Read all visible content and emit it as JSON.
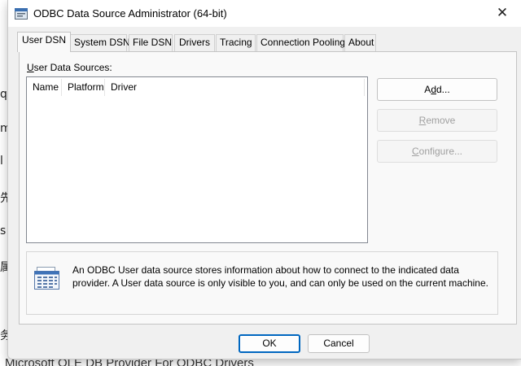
{
  "background_fragments": {
    "chars": [
      "q",
      "m",
      "l",
      "先",
      "s",
      "属",
      "务"
    ],
    "bottom_text": "Microsoft OLE DB Provider For ODBC Drivers"
  },
  "window": {
    "title": "ODBC Data Source Administrator (64-bit)",
    "close_symbol": "✕"
  },
  "tabs": [
    {
      "label": "User DSN",
      "active": true
    },
    {
      "label": "System DSN",
      "active": false
    },
    {
      "label": "File DSN",
      "active": false
    },
    {
      "label": "Drivers",
      "active": false
    },
    {
      "label": "Tracing",
      "active": false
    },
    {
      "label": "Connection Pooling",
      "active": false
    },
    {
      "label": "About",
      "active": false
    }
  ],
  "user_dsn": {
    "sources_label_pre": "U",
    "sources_label_rest": "ser Data Sources:",
    "columns": [
      "Name",
      "Platform",
      "Driver"
    ],
    "rows": [],
    "buttons": {
      "add": {
        "pre": "A",
        "u": "d",
        "post": "d...",
        "enabled": true
      },
      "remove": {
        "pre": "",
        "u": "R",
        "post": "emove",
        "enabled": false
      },
      "configure": {
        "pre": "",
        "u": "C",
        "post": "onfigure...",
        "enabled": false
      }
    },
    "info_text": "An ODBC User data source stores information about how to connect to the indicated data provider.   A User data source is only visible to you, and can only be used on the current machine."
  },
  "dialog_buttons": {
    "ok": "OK",
    "cancel": "Cancel"
  },
  "colors": {
    "accent": "#0067c0",
    "window_bg": "#f0f0f0",
    "disabled_text": "#a0a0a0"
  }
}
